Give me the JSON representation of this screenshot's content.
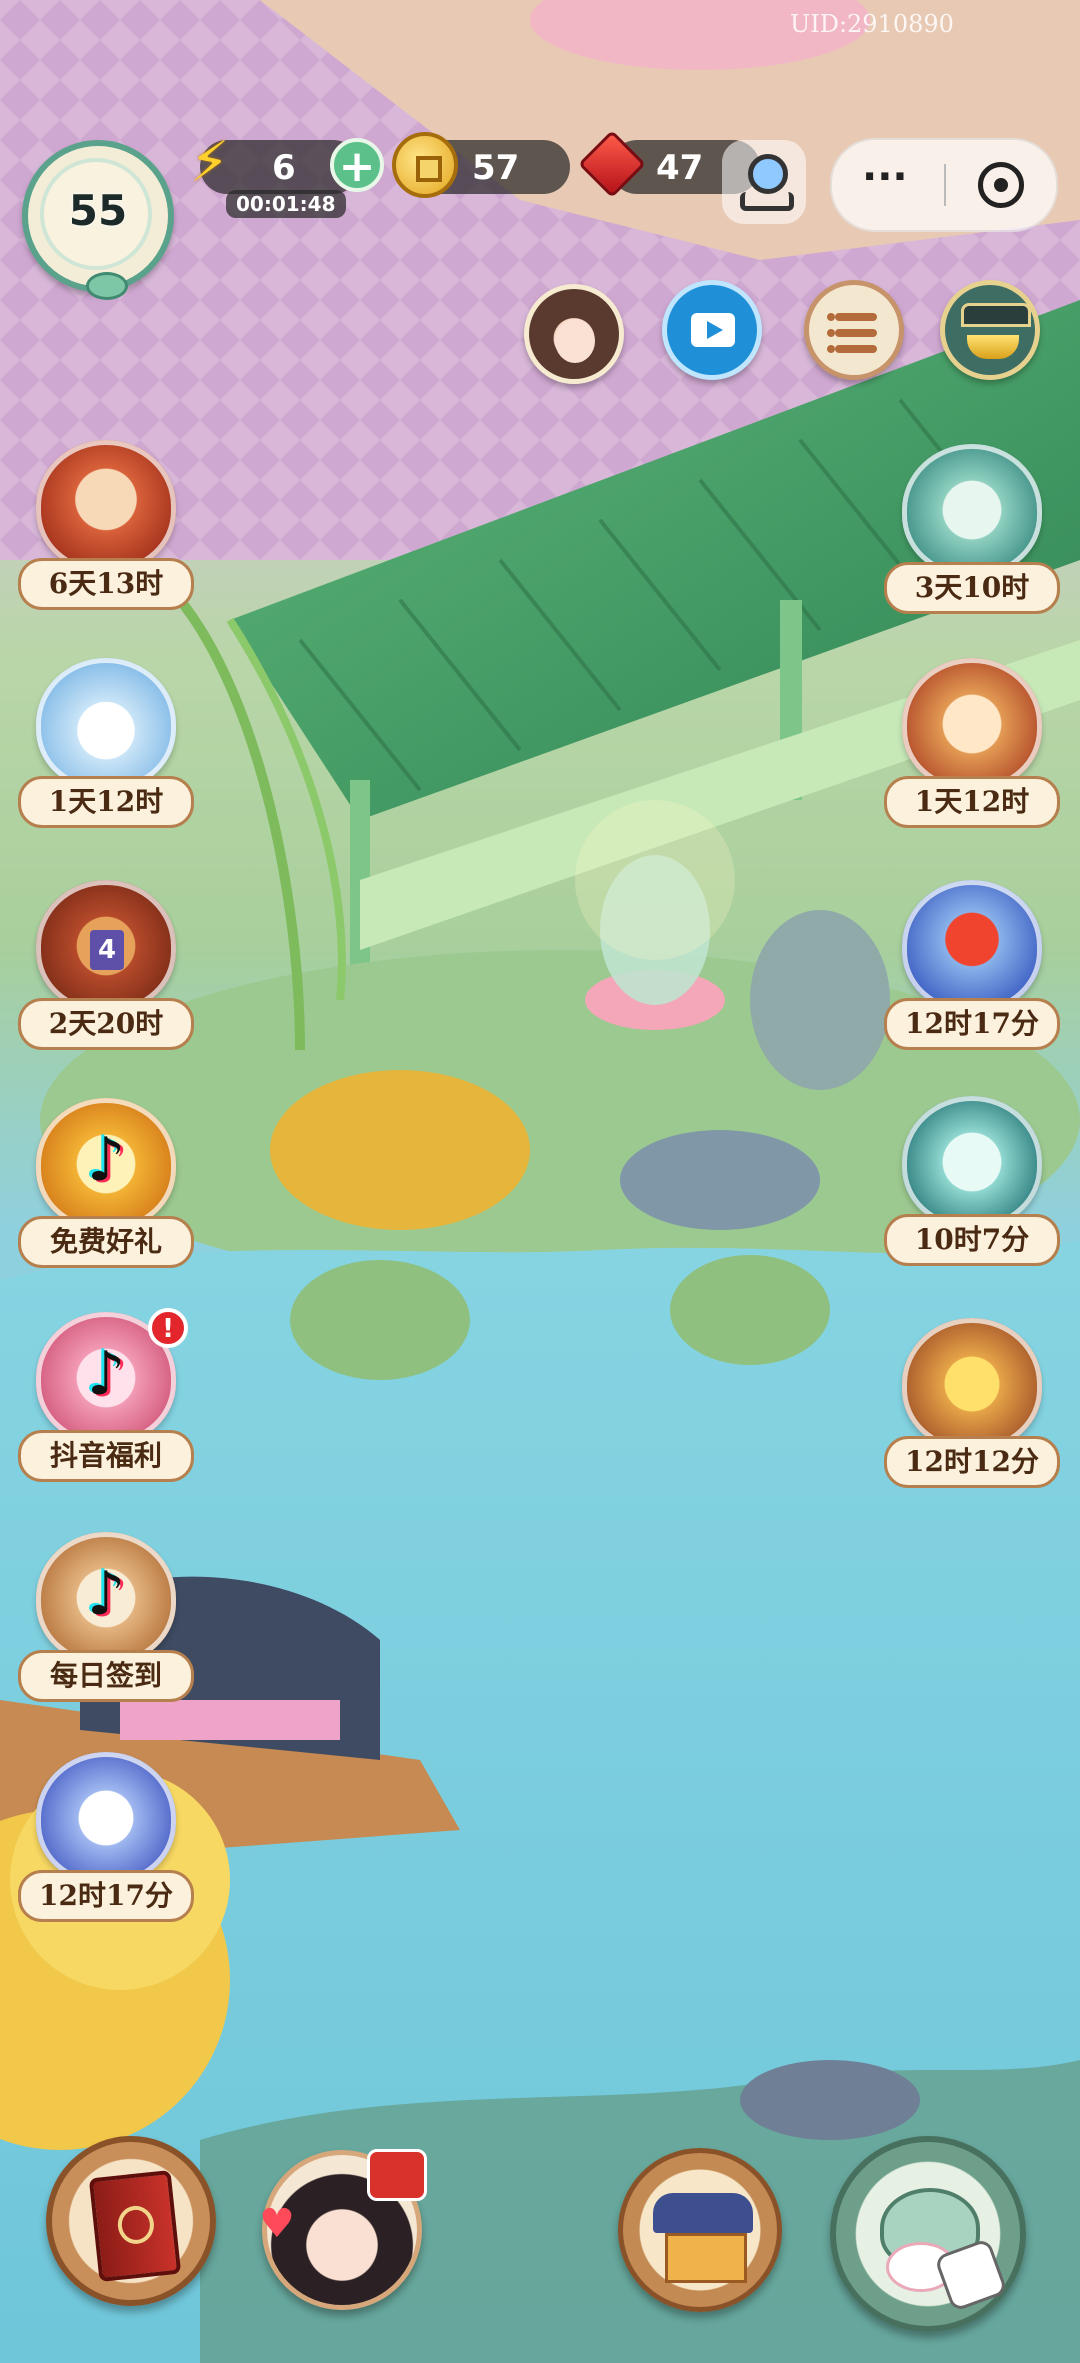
{
  "hud": {
    "level": "55",
    "energy": "6",
    "energy_timer": "00:01:48",
    "coins": "57",
    "gems": "47",
    "uid": "UID:2910890",
    "menu_more": "···"
  },
  "left_events": [
    {
      "id": "autumn-letters",
      "label": "6天13时"
    },
    {
      "id": "snow-cats",
      "label": "1天12时"
    },
    {
      "id": "gift-chest",
      "label": "2天20时",
      "tag": "4"
    },
    {
      "id": "free-gift",
      "label": "免费好礼"
    },
    {
      "id": "douyin-welfare",
      "label": "抖音福利",
      "badge": "!"
    },
    {
      "id": "daily-signin",
      "label": "每日签到"
    },
    {
      "id": "kite-event",
      "label": "12时17分"
    }
  ],
  "right_events": [
    {
      "id": "bath-cat",
      "label": "3天10时"
    },
    {
      "id": "fan-cat",
      "label": "1天12时"
    },
    {
      "id": "red-fan",
      "label": "12时17分"
    },
    {
      "id": "gift-box-cat",
      "label": "10时7分"
    },
    {
      "id": "coin-cards",
      "label": "12时12分"
    }
  ],
  "colors": {
    "label_bg": "#fbf1dc",
    "label_border": "#b57f4e",
    "label_text": "#4a2a12",
    "water": "#7fd1e0",
    "roof_green": "#3f9a63",
    "energy_plus": "#5cc08b",
    "gem_red": "#d9262a",
    "badge_red": "#e3262b"
  },
  "icons": {
    "energy": "lightning-bolt-icon",
    "add": "plus-icon",
    "coin": "coin-icon",
    "gem": "red-gem-icon",
    "joystick": "joystick-icon",
    "more": "more-dots-icon",
    "close": "circle-target-icon",
    "video": "video-play-icon",
    "list": "list-icon",
    "shop": "gold-ingot-shop-icon",
    "book": "red-book-icon",
    "character": "character-portrait-icon",
    "house": "house-building-icon",
    "teapot": "teapot-bunny-icon"
  }
}
